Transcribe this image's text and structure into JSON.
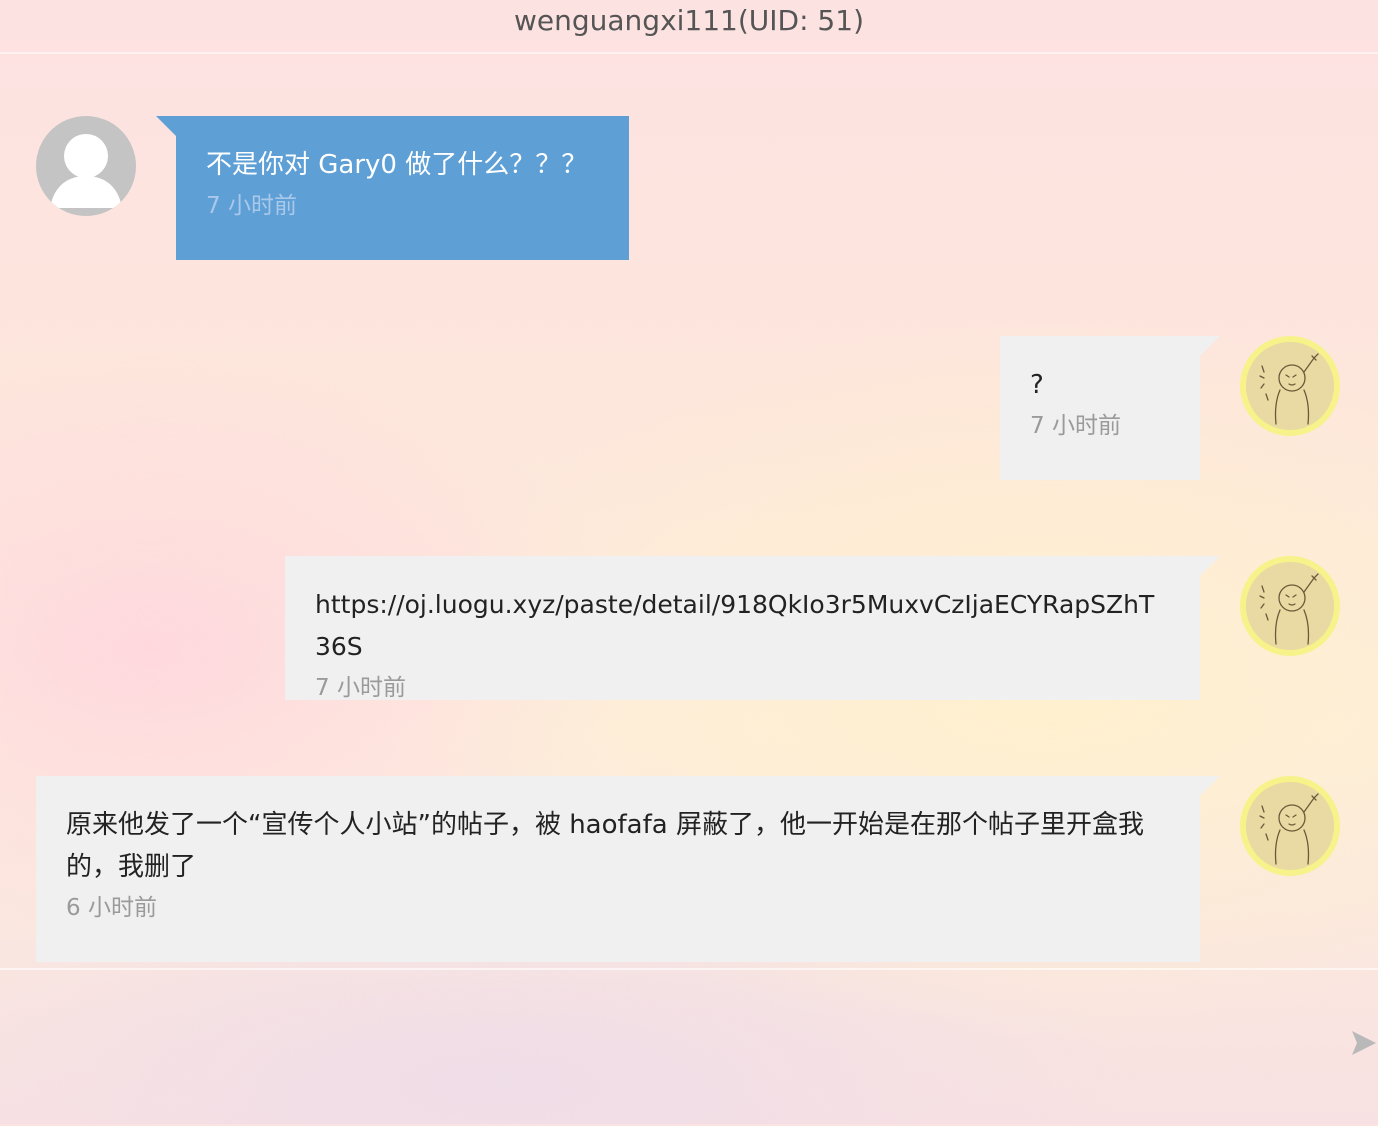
{
  "header": {
    "title": "wenguangxi111(UID: 51)"
  },
  "messages": [
    {
      "side": "left",
      "avatar": "default-avatar-icon",
      "text": "不是你对 Gary0 做了什么？？？",
      "time": "7 小时前"
    },
    {
      "side": "right",
      "avatar": "user-avatar-icon",
      "text": "?",
      "time": "7 小时前"
    },
    {
      "side": "right",
      "avatar": "user-avatar-icon",
      "text": "https://oj.luogu.xyz/paste/detail/918QkIo3r5MuxvCzIjaECYRapSZhT36S",
      "time": "7 小时前"
    },
    {
      "side": "right",
      "avatar": "user-avatar-icon",
      "text": "原来他发了一个“宣传个人小站”的帖子，被 haofafa 屏蔽了，他一开始是在那个帖子里开盒我的，我删了",
      "time": "6 小时前"
    }
  ],
  "composer": {
    "send_icon": "send-arrow-icon"
  },
  "colors": {
    "sent_bubble": "#5e9fd6",
    "received_bubble": "#f0f0f0",
    "avatar_ring": "#f7f28a"
  }
}
